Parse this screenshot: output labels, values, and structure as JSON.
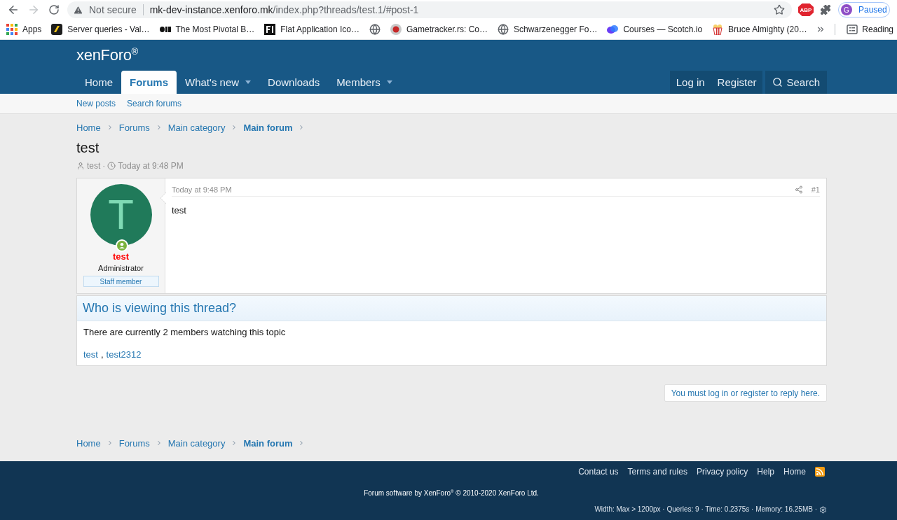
{
  "browser": {
    "nav_buttons": [
      {
        "kind": "back",
        "disabled": false
      },
      {
        "kind": "forward",
        "disabled": true
      },
      {
        "kind": "reload",
        "disabled": false
      }
    ],
    "security": "Not secure",
    "url_host": "mk-dev-instance.xenforo.mk",
    "url_path": "/index.php?threads/test.1/#post-1",
    "extension_badge": "ABP",
    "profile": {
      "initial": "G",
      "status": "Paused"
    }
  },
  "bookmarks": [
    {
      "kind": "apps",
      "label": "Apps"
    },
    {
      "kind": "site",
      "label": "Server queries - Val…"
    },
    {
      "kind": "site",
      "label": "The Most Pivotal B…"
    },
    {
      "kind": "site",
      "label": "Flat Application Ico…"
    },
    {
      "kind": "site"
    },
    {
      "kind": "site",
      "label": "Gametracker.rs: Co…"
    },
    {
      "kind": "site",
      "label": "Schwarzenegger Fo…"
    },
    {
      "kind": "site",
      "label": "Courses — Scotch.io"
    },
    {
      "kind": "site",
      "label": "Bruce Almighty (20…"
    }
  ],
  "reading_list": "Reading",
  "header": {
    "logo": "xenForo$^{®}$",
    "nav_tabs": [
      {
        "label": "Home",
        "selected": false,
        "has_menu": false
      },
      {
        "label": "Forums",
        "selected": true,
        "has_menu": false
      },
      {
        "label": "What's new",
        "selected": false,
        "has_menu": true
      },
      {
        "label": "Downloads",
        "selected": false,
        "has_menu": false
      },
      {
        "label": "Members",
        "selected": false,
        "has_menu": true
      }
    ],
    "account_links": [
      "Log in",
      "Register"
    ],
    "search_label": "Search"
  },
  "sub_nav": [
    "New posts",
    "Search forums"
  ],
  "breadcrumb_top": [
    {
      "label": "Home",
      "current": false
    },
    {
      "label": "Forums",
      "current": false
    },
    {
      "label": "Main category",
      "current": false
    },
    {
      "label": "Main forum",
      "current": true
    }
  ],
  "thread": {
    "title": "test",
    "author": "test",
    "separator": "·",
    "date": "Today at 9:48 PM"
  },
  "post": {
    "user": {
      "avatar_letter": "T",
      "name": "test",
      "title": "Administrator",
      "banner": "Staff member",
      "online": true
    },
    "date": "Today at 9:48 PM",
    "number": "#1",
    "body": "test"
  },
  "viewers": {
    "title": "Who is viewing this thread?",
    "summary": "There are currently 2 members watching this topic",
    "members": [
      "test",
      "test2312"
    ],
    "separator": ","
  },
  "reply_notice": "You must log in or register to reply here.",
  "breadcrumb_bottom": [
    {
      "label": "Home",
      "current": false
    },
    {
      "label": "Forums",
      "current": false
    },
    {
      "label": "Main category",
      "current": false
    },
    {
      "label": "Main forum",
      "current": true
    }
  ],
  "footer": {
    "links": [
      "Contact us",
      "Terms and rules",
      "Privacy policy",
      "Help",
      "Home"
    ],
    "copyright": "Forum software by XenForo$^{®}$ © 2010-2020 XenForo Ltd.",
    "debug": "Width: Max > 1200px · Queries: 9 · Time: 0.2375s · Memory: 16.25MB ·"
  }
}
